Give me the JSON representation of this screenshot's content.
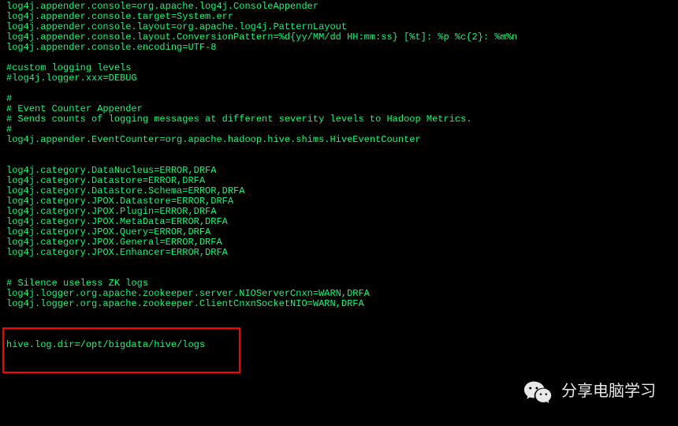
{
  "config_lines": [
    "log4j.appender.console=org.apache.log4j.ConsoleAppender",
    "log4j.appender.console.target=System.err",
    "log4j.appender.console.layout=org.apache.log4j.PatternLayout",
    "log4j.appender.console.layout.ConversionPattern=%d{yy/MM/dd HH:mm:ss} [%t]: %p %c{2}: %m%n",
    "log4j.appender.console.encoding=UTF-8",
    "",
    "#custom logging levels",
    "#log4j.logger.xxx=DEBUG",
    "",
    "#",
    "# Event Counter Appender",
    "# Sends counts of logging messages at different severity levels to Hadoop Metrics.",
    "#",
    "log4j.appender.EventCounter=org.apache.hadoop.hive.shims.HiveEventCounter",
    "",
    "",
    "log4j.category.DataNucleus=ERROR,DRFA",
    "log4j.category.Datastore=ERROR,DRFA",
    "log4j.category.Datastore.Schema=ERROR,DRFA",
    "log4j.category.JPOX.Datastore=ERROR,DRFA",
    "log4j.category.JPOX.Plugin=ERROR,DRFA",
    "log4j.category.JPOX.MetaData=ERROR,DRFA",
    "log4j.category.JPOX.Query=ERROR,DRFA",
    "log4j.category.JPOX.General=ERROR,DRFA",
    "log4j.category.JPOX.Enhancer=ERROR,DRFA",
    "",
    "",
    "# Silence useless ZK logs",
    "log4j.logger.org.apache.zookeeper.server.NIOServerCnxn=WARN,DRFA",
    "log4j.logger.org.apache.zookeeper.ClientCnxnSocketNIO=WARN,DRFA",
    "",
    "",
    "",
    "hive.log.dir=/opt/bigdata/hive/logs"
  ],
  "watermark": {
    "text": "分享电脑学习"
  }
}
